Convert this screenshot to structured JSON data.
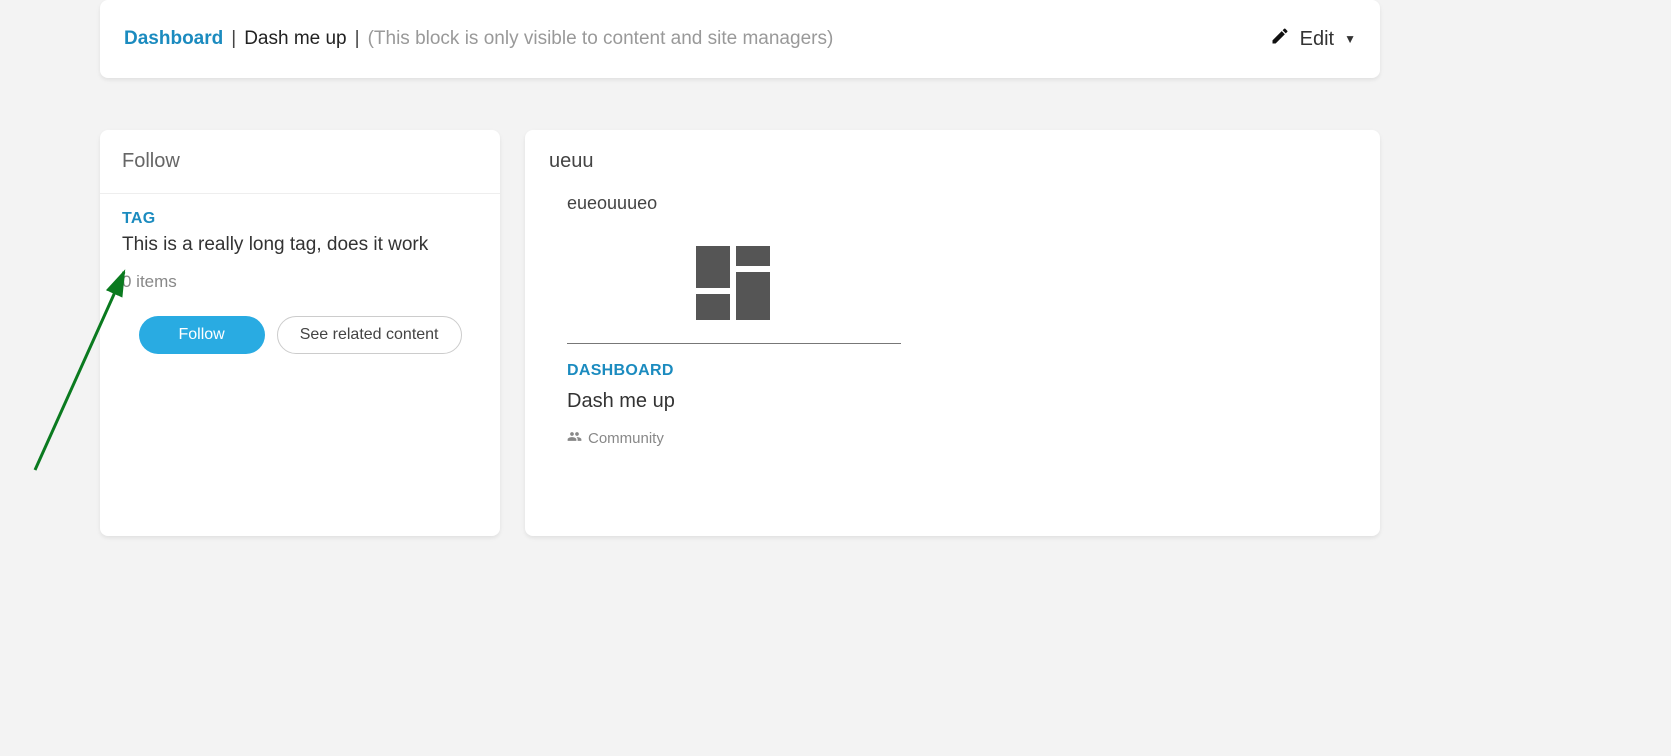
{
  "header": {
    "breadcrumb_link": "Dashboard",
    "separator": "|",
    "title": "Dash me up",
    "note": "(This block is only visible to content and site managers)",
    "edit_label": "Edit"
  },
  "follow_card": {
    "header": "Follow",
    "tag_label": "TAG",
    "tag_name": "This is a really long tag, does it work",
    "item_count_text": "0 items",
    "follow_btn": "Follow",
    "related_btn": "See related content"
  },
  "content_card": {
    "title": "ueuu",
    "subtitle": "eueouuueo",
    "item": {
      "type_label": "DASHBOARD",
      "name": "Dash me up",
      "community_label": "Community"
    }
  }
}
